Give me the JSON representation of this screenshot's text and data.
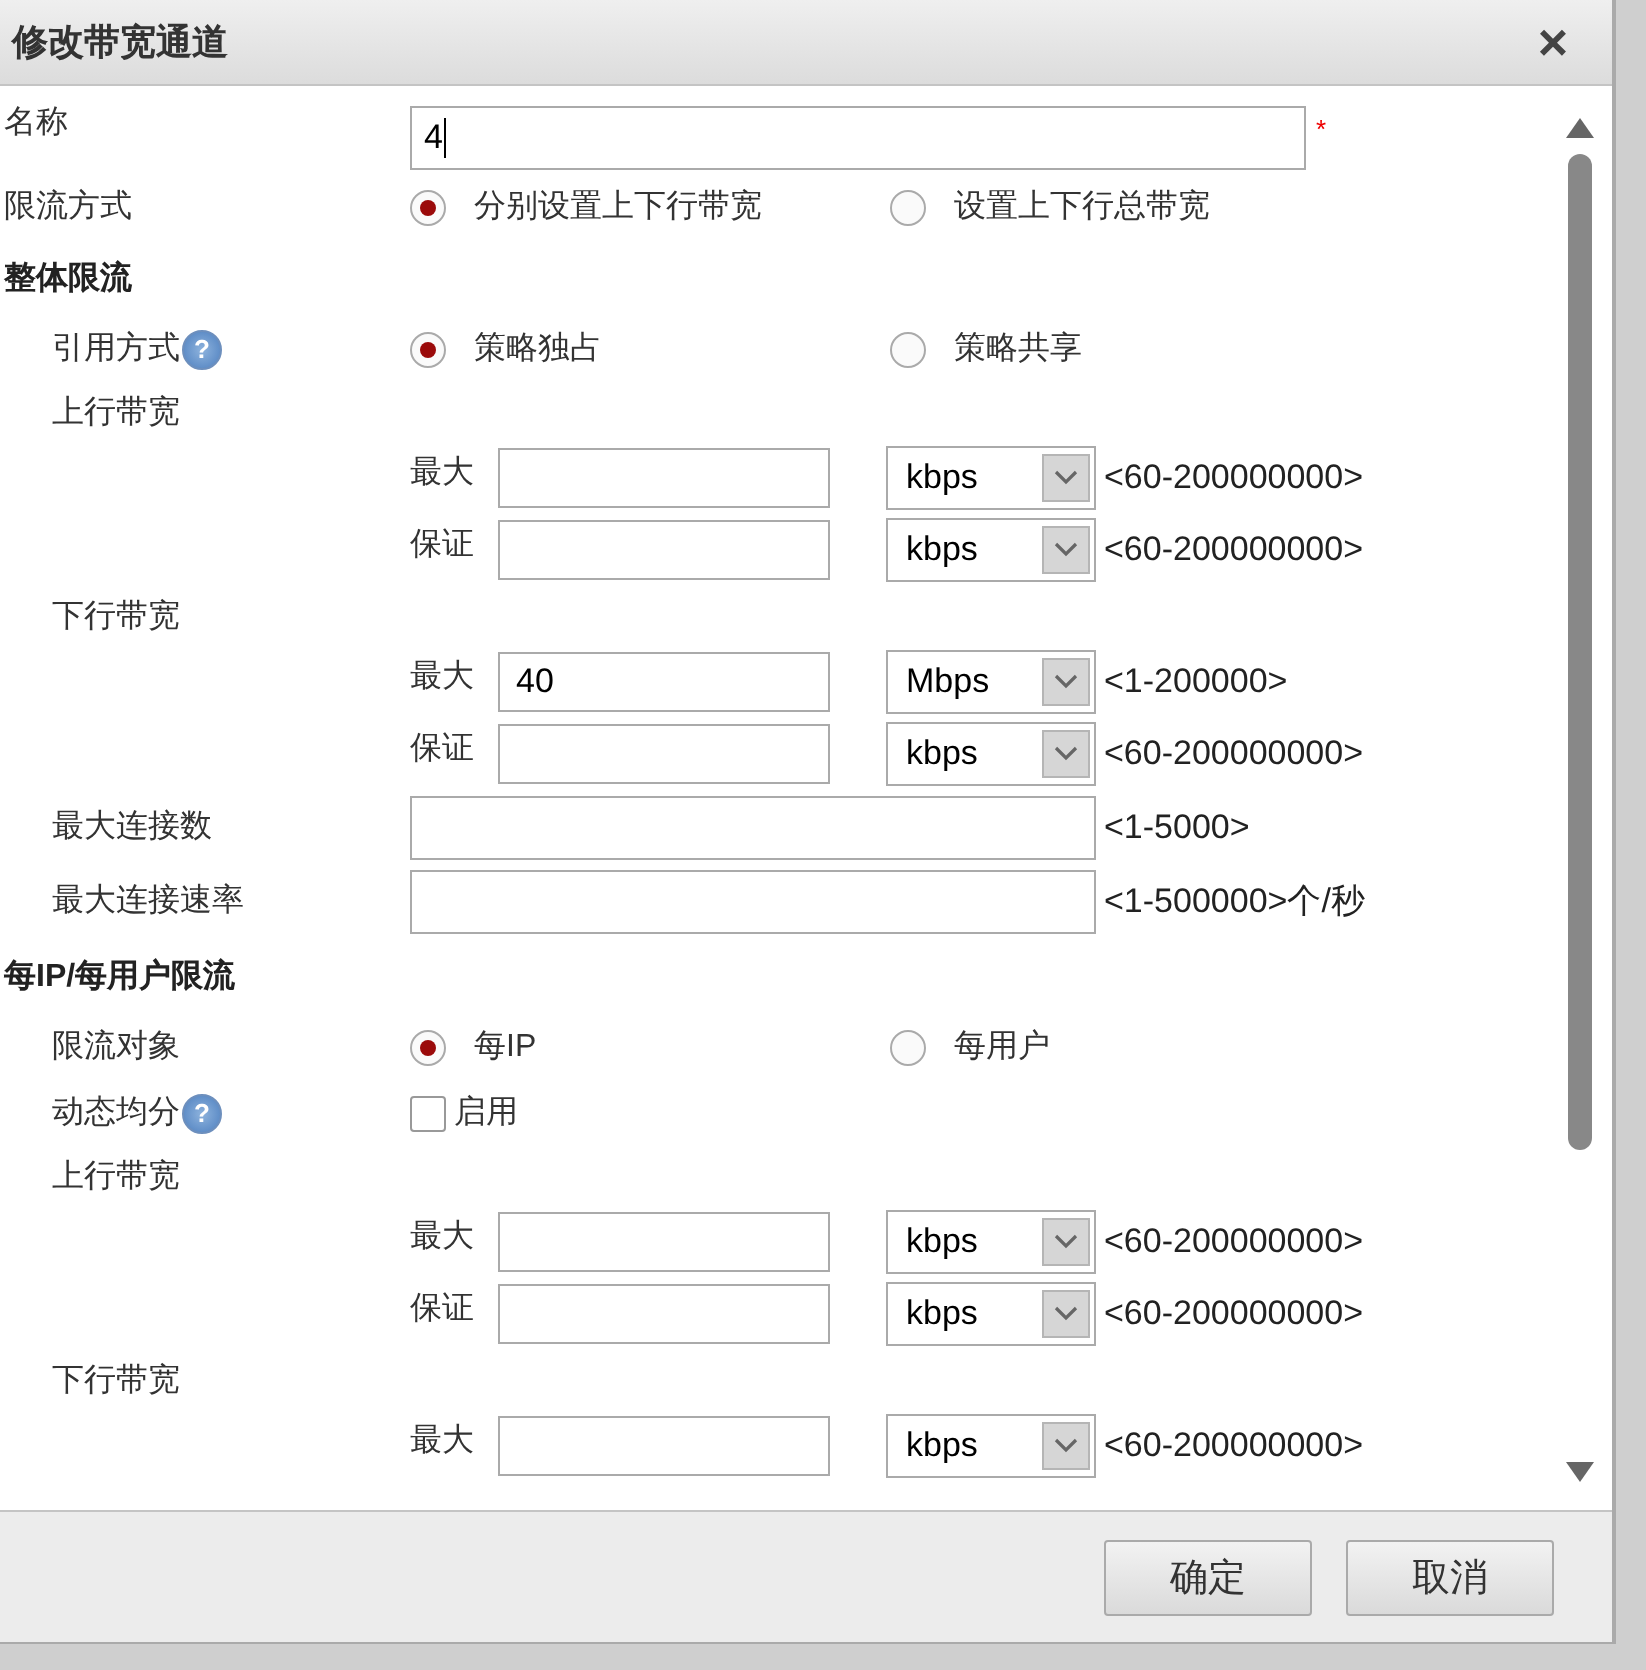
{
  "dialog": {
    "title": "修改带宽通道",
    "close": "×"
  },
  "rows": [
    {
      "kind": "text",
      "label": "名称",
      "value": "4",
      "required": "*"
    },
    {
      "kind": "radio",
      "label": "限流方式",
      "indent": false,
      "options": [
        {
          "label": "分别设置上下行带宽",
          "selected": true
        },
        {
          "label": "设置上下行总带宽",
          "selected": false
        }
      ]
    },
    {
      "kind": "section",
      "label": "整体限流"
    },
    {
      "kind": "radio",
      "label": "引用方式",
      "indent": true,
      "help": "?",
      "options": [
        {
          "label": "策略独占",
          "selected": true
        },
        {
          "label": "策略共享",
          "selected": false
        }
      ]
    },
    {
      "kind": "subheading",
      "label": "上行带宽"
    },
    {
      "kind": "bandwidth",
      "label": "最大",
      "value": "",
      "unit": "kbps",
      "range": "<60-200000000>"
    },
    {
      "kind": "bandwidth",
      "label": "保证",
      "value": "",
      "unit": "kbps",
      "range": "<60-200000000>"
    },
    {
      "kind": "subheading",
      "label": "下行带宽"
    },
    {
      "kind": "bandwidth",
      "label": "最大",
      "value": "40",
      "unit": "Mbps",
      "range": "<1-200000>"
    },
    {
      "kind": "bandwidth",
      "label": "保证",
      "value": "",
      "unit": "kbps",
      "range": "<60-200000000>"
    },
    {
      "kind": "wide",
      "label": "最大连接数",
      "value": "",
      "range": "<1-5000>"
    },
    {
      "kind": "wide",
      "label": "最大连接速率",
      "value": "",
      "range": "<1-500000>个/秒"
    },
    {
      "kind": "section",
      "label": "每IP/每用户限流"
    },
    {
      "kind": "radio",
      "label": "限流对象",
      "indent": true,
      "options": [
        {
          "label": "每IP",
          "selected": true
        },
        {
          "label": "每用户",
          "selected": false
        }
      ]
    },
    {
      "kind": "checkbox",
      "label": "动态均分",
      "help": "?",
      "option": "启用",
      "checked": false
    },
    {
      "kind": "subheading",
      "label": "上行带宽"
    },
    {
      "kind": "bandwidth",
      "label": "最大",
      "value": "",
      "unit": "kbps",
      "range": "<60-200000000>"
    },
    {
      "kind": "bandwidth",
      "label": "保证",
      "value": "",
      "unit": "kbps",
      "range": "<60-200000000>"
    },
    {
      "kind": "subheading",
      "label": "下行带宽"
    },
    {
      "kind": "bandwidth",
      "label": "最大",
      "value": "",
      "unit": "kbps",
      "range": "<60-200000000>"
    }
  ],
  "buttons": [
    "确定",
    "取消"
  ]
}
